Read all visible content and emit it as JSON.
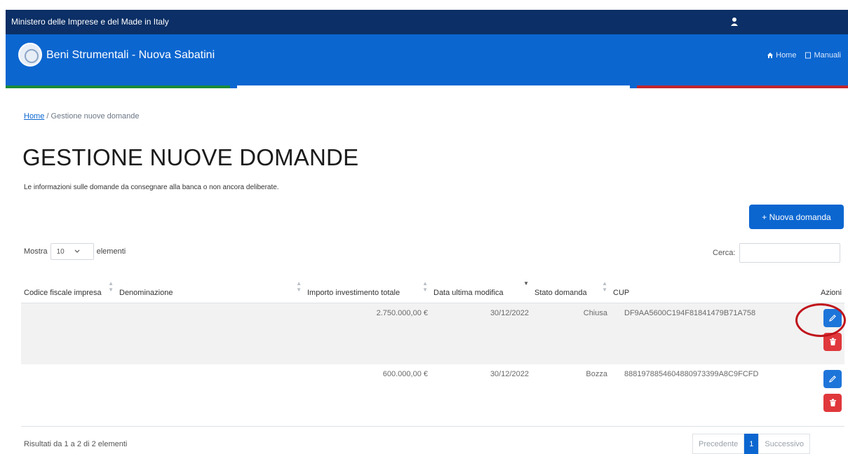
{
  "header": {
    "ministry": "Ministero delle Imprese e del Made in Italy",
    "app_title": "Beni Strumentali - Nuova Sabatini",
    "nav": [
      {
        "label": "Home",
        "icon": "home-icon"
      },
      {
        "label": "Manuali",
        "icon": "book-icon"
      }
    ],
    "stripe_colors": [
      "#1b8a3a",
      "#0b66d0",
      "#ffffff",
      "#0b66d0",
      "#c0262d"
    ]
  },
  "breadcrumb": {
    "home": "Home",
    "separator": "/",
    "current": "Gestione nuove domande"
  },
  "page": {
    "title": "GESTIONE NUOVE DOMANDE",
    "subtitle": "Le informazioni sulle domande da consegnare alla banca o non ancora deliberate.",
    "new_button": "+ Nuova domanda"
  },
  "controls": {
    "show_label": "Mostra",
    "page_size": "10",
    "elements_label": "elementi",
    "search_label": "Cerca:",
    "search_value": ""
  },
  "table": {
    "columns": [
      "Codice fiscale impresa",
      "Denominazione",
      "Importo investimento totale",
      "Data ultima modifica",
      "Stato domanda",
      "CUP",
      "Azioni"
    ],
    "rows": [
      {
        "codice": "",
        "denominazione": "",
        "importo": "2.750.000,00 €",
        "data": "30/12/2022",
        "stato": "Chiusa",
        "cup": "DF9AA5600C194F81841479B71A758"
      },
      {
        "codice": "",
        "denominazione": "",
        "importo": "600.000,00 €",
        "data": "30/12/2022",
        "stato": "Bozza",
        "cup": "8881978854604880973399A8C9FCFD"
      }
    ]
  },
  "footer": {
    "results": "Risultati da 1 a 2 di 2 elementi",
    "prev": "Precedente",
    "page": "1",
    "next": "Successivo"
  },
  "colors": {
    "topbar": "#0b2f66",
    "appbar": "#0b66d0",
    "edit": "#1e75d9",
    "delete": "#e0383c",
    "highlight": "#c0141b"
  }
}
